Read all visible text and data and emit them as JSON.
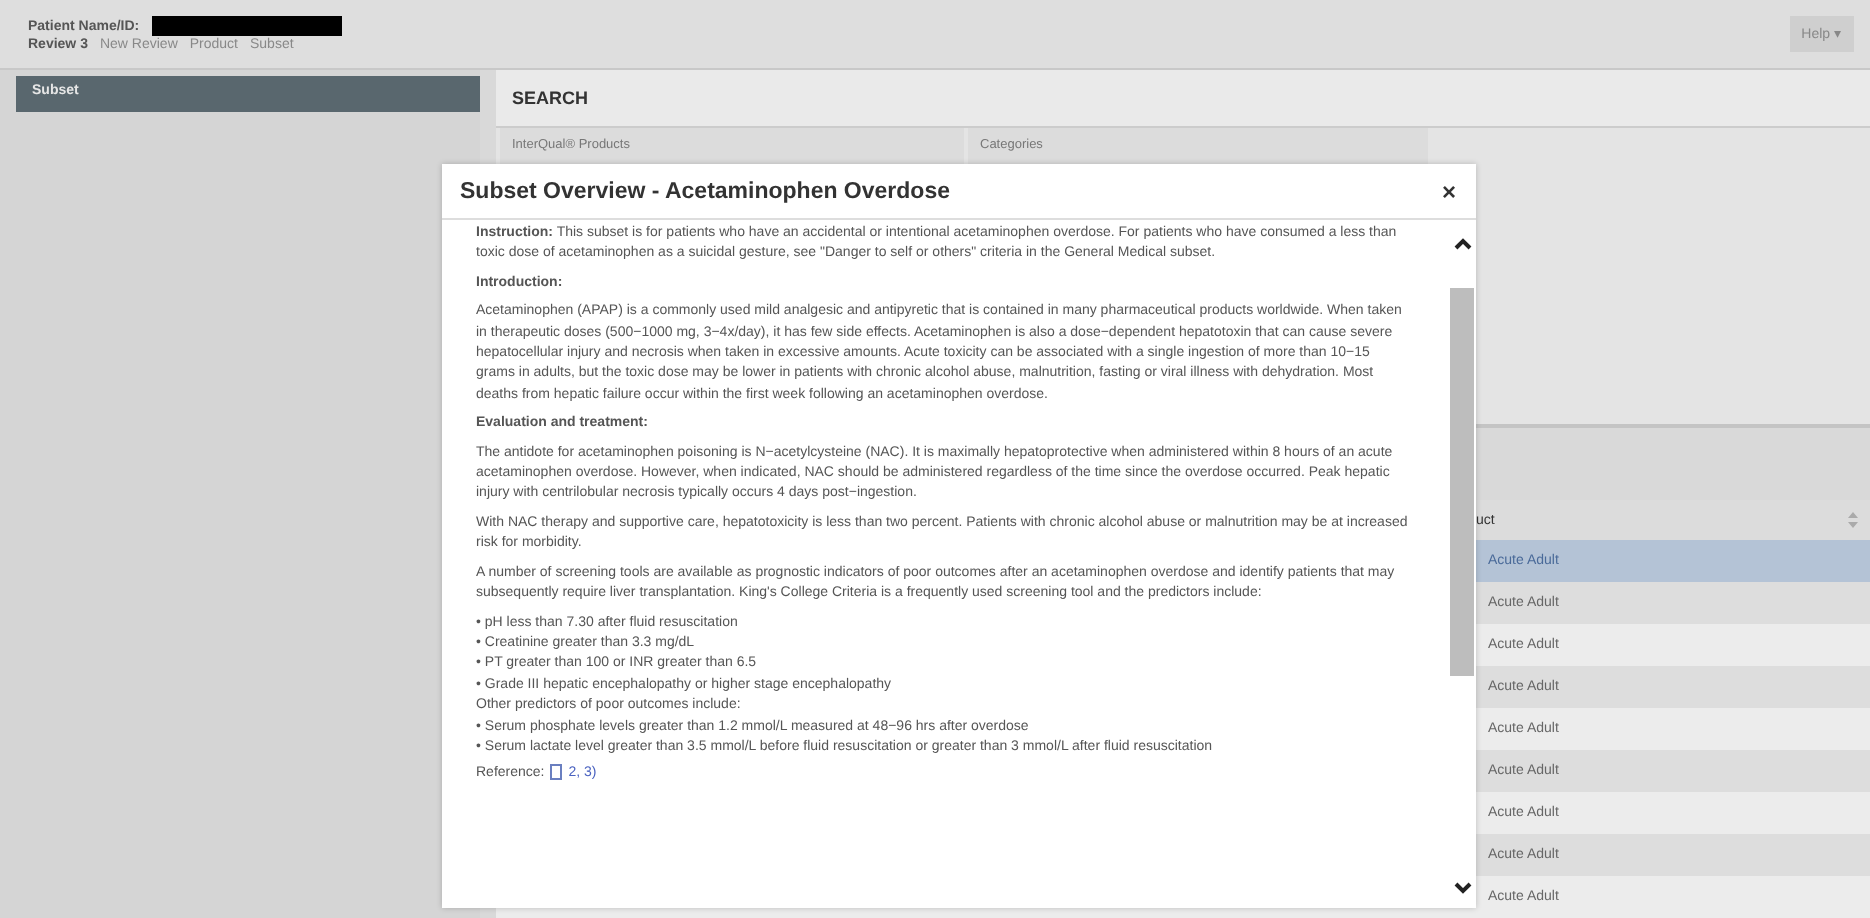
{
  "header": {
    "patient_label": "Patient Name/ID:",
    "review_label": "Review 3",
    "breadcrumb": [
      "New Review",
      "Product",
      "Subset"
    ],
    "help_button": "Help ▾"
  },
  "sidebar": {
    "items": [
      {
        "label": "Subset",
        "selected": true
      }
    ]
  },
  "search": {
    "title": "SEARCH",
    "columns": [
      "InterQual® Products",
      "Categories"
    ]
  },
  "table": {
    "column": "uct",
    "rows": [
      {
        "cell": "Acute Adult",
        "selected": true
      },
      {
        "cell": "Acute Adult",
        "selected": false
      },
      {
        "cell": "Acute Adult",
        "selected": false
      },
      {
        "cell": "Acute Adult",
        "selected": false
      },
      {
        "cell": "Acute Adult",
        "selected": false
      },
      {
        "cell": "Acute Adult",
        "selected": false
      },
      {
        "cell": "Acute Adult",
        "selected": false
      },
      {
        "cell": "Acute Adult",
        "selected": false
      },
      {
        "cell": "Acute Adult",
        "selected": false
      }
    ]
  },
  "modal": {
    "title": "Subset Overview - Acetaminophen Overdose",
    "close": "×",
    "blocks": [
      {
        "kind": "para",
        "text": "**Instruction:** This subset is for patients who have an accidental or intentional acetaminophen overdose. For patients who have consumed a less than toxic dose of acetaminophen as a suicidal gesture, see \"Danger to self or others\" criteria in the General Medical subset."
      },
      {
        "kind": "heading",
        "text": "Introduction:"
      },
      {
        "kind": "para",
        "text": "Acetaminophen (APAP) is a commonly used mild analgesic and antipyretic that is contained in many pharmaceutical products worldwide. When taken in therapeutic doses (500−1000 mg, 3−4x/day), it has few side effects. Acetaminophen is also a dose−dependent hepatotoxin that can cause severe hepatocellular injury and necrosis when taken in excessive amounts. Acute toxicity can be associated with a single ingestion of more than 10−15 grams in adults, but the toxic dose may be lower in patients with chronic alcohol abuse, malnutrition, fasting or viral illness with dehydration. Most deaths from hepatic failure occur within the first week following an acetaminophen overdose."
      },
      {
        "kind": "heading",
        "text": "Evaluation and treatment:"
      },
      {
        "kind": "para",
        "text": "The antidote for acetaminophen poisoning is N−acetylcysteine (NAC). It is maximally hepatoprotective when administered within 8 hours of an acute acetaminophen overdose. However, when indicated, NAC should be administered regardless of the time since the overdose occurred. Peak hepatic injury with centrilobular necrosis typically occurs 4 days post−ingestion."
      },
      {
        "kind": "para",
        "text": "With NAC therapy and supportive care, hepatotoxicity is less than two percent. Patients with chronic alcohol abuse or malnutrition may be at increased risk for morbidity."
      },
      {
        "kind": "para",
        "text": "A number of screening tools are available as prognostic indicators of poor outcomes after an acetaminophen overdose and identify patients that may subsequently require liver transplantation. King's College Criteria is a frequently used screening tool and the predictors include:"
      },
      {
        "kind": "bullet",
        "text": "• pH less than 7.30 after fluid resuscitation"
      },
      {
        "kind": "bullet",
        "text": "• Creatinine greater than 3.3 mg/dL"
      },
      {
        "kind": "bullet",
        "text": "• PT greater than 100 or INR greater than 6.5"
      },
      {
        "kind": "bullet",
        "text": "• Grade III hepatic encephalopathy or higher stage encephalopathy"
      },
      {
        "kind": "lead",
        "text": "Other predictors of poor outcomes include:"
      },
      {
        "kind": "bullet",
        "text": "• Serum phosphate levels greater than 1.2 mmol/L measured at 48−96 hrs after overdose"
      },
      {
        "kind": "bullet",
        "text": "• Serum lactate level greater than 3.5 mmol/L before fluid resuscitation or greater than 3 mmol/L after fluid resuscitation"
      },
      {
        "kind": "reference",
        "text": "Reference:",
        "link": "2, 3)"
      }
    ]
  }
}
